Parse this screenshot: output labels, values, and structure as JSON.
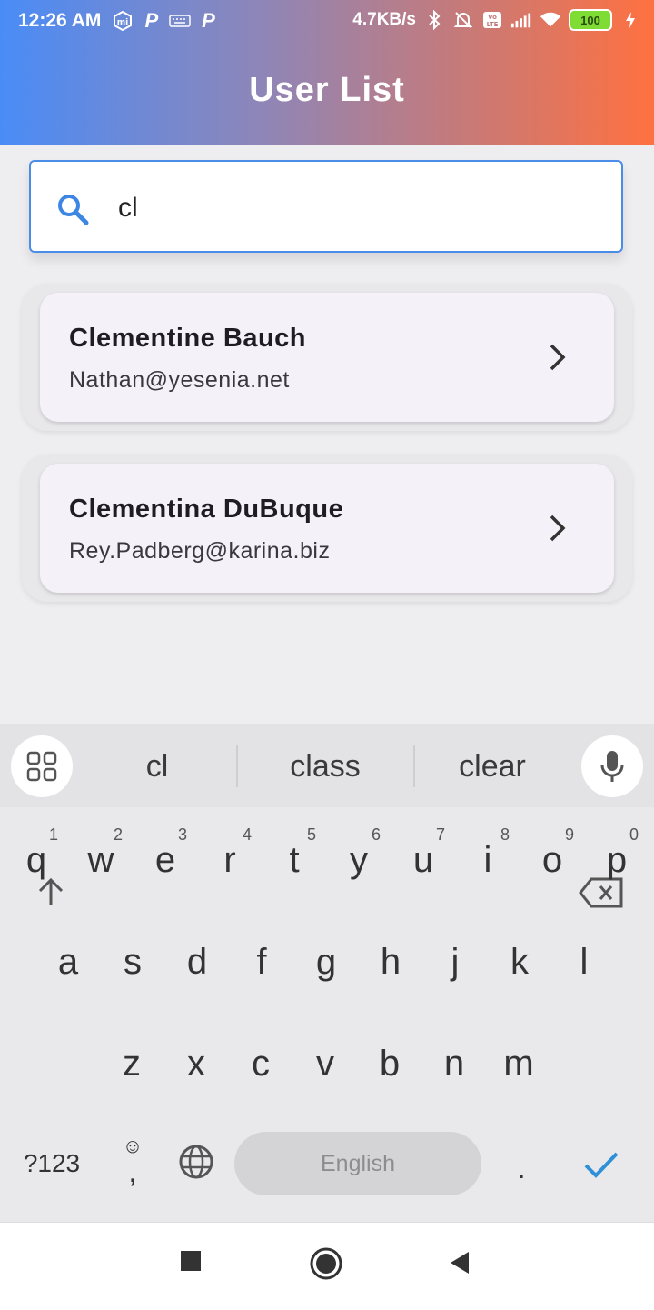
{
  "status": {
    "time": "12:26 AM",
    "net_speed": "4.7KB/s",
    "battery": "100"
  },
  "header": {
    "title": "User List"
  },
  "search": {
    "value": "cl",
    "placeholder": ""
  },
  "users": [
    {
      "name": "Clementine Bauch",
      "email": "Nathan@yesenia.net"
    },
    {
      "name": "Clementina DuBuque",
      "email": "Rey.Padberg@karina.biz"
    }
  ],
  "keyboard": {
    "suggestions": [
      "cl",
      "class",
      "clear"
    ],
    "row1": [
      "q",
      "w",
      "e",
      "r",
      "t",
      "y",
      "u",
      "i",
      "o",
      "p"
    ],
    "row1_hints": [
      "1",
      "2",
      "3",
      "4",
      "5",
      "6",
      "7",
      "8",
      "9",
      "0"
    ],
    "row2": [
      "a",
      "s",
      "d",
      "f",
      "g",
      "h",
      "j",
      "k",
      "l"
    ],
    "row3": [
      "z",
      "x",
      "c",
      "v",
      "b",
      "n",
      "m"
    ],
    "symbols_label": "?123",
    "comma": ",",
    "period": ".",
    "space_label": "English"
  },
  "colors": {
    "accent": "#4a8de9",
    "header_start": "#4a8cf6",
    "header_end": "#ff7140",
    "confirm": "#2f8fd8"
  }
}
